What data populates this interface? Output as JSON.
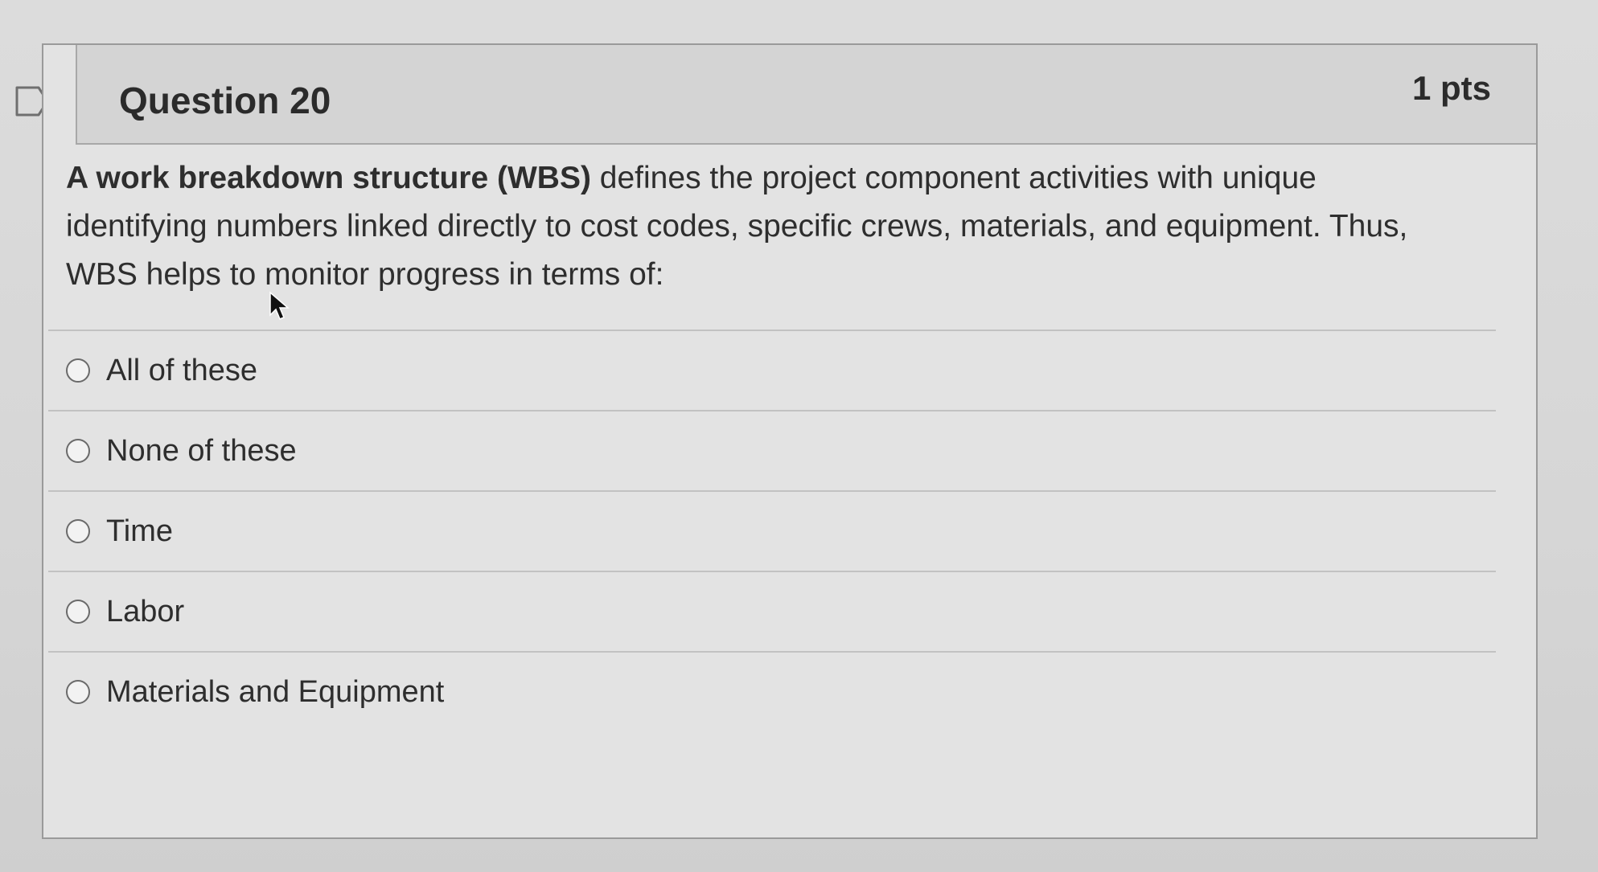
{
  "question": {
    "title": "Question 20",
    "points": "1 pts",
    "text_bold": "A work breakdown structure (WBS)",
    "text_rest": " defines the project component activities with unique identifying numbers linked directly to cost codes, specific crews, materials, and equipment. Thus, WBS helps to monitor progress in terms of:"
  },
  "answers": [
    {
      "label": "All of these"
    },
    {
      "label": "None of these"
    },
    {
      "label": "Time"
    },
    {
      "label": "Labor"
    },
    {
      "label": "Materials and Equipment"
    }
  ],
  "icons": {
    "flag": "flag-icon",
    "cursor": "mouse-pointer-icon"
  }
}
